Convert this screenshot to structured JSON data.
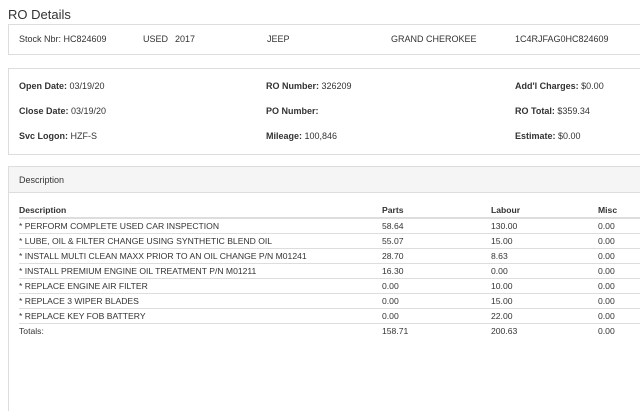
{
  "page_title": "RO Details",
  "vehicle": {
    "stock": "Stock Nbr: HC824609",
    "condition": "USED",
    "year": "2017",
    "make": "JEEP",
    "model": "GRAND CHEROKEE",
    "vin": "1C4RJFAG0HC824609"
  },
  "ro_info": {
    "open_date": {
      "label": "Open Date:",
      "value": "03/19/20"
    },
    "close_date": {
      "label": "Close Date:",
      "value": "03/19/20"
    },
    "svc_logon": {
      "label": "Svc Logon:",
      "value": "HZF-S"
    },
    "ro_number": {
      "label": "RO Number:",
      "value": "326209"
    },
    "po_number": {
      "label": "PO Number:",
      "value": ""
    },
    "mileage": {
      "label": "Mileage:",
      "value": "100,846"
    },
    "addl_charges": {
      "label": "Add'l Charges:",
      "value": "$0.00"
    },
    "ro_total": {
      "label": "RO Total:",
      "value": "$359.34"
    },
    "estimate": {
      "label": "Estimate:",
      "value": "$0.00"
    }
  },
  "description_panel": {
    "heading": "Description",
    "columns": {
      "description": "Description",
      "parts": "Parts",
      "labour": "Labour",
      "misc": "Misc"
    },
    "rows": [
      {
        "description": "* PERFORM COMPLETE USED CAR INSPECTION",
        "parts": "58.64",
        "labour": "130.00",
        "misc": "0.00"
      },
      {
        "description": "* LUBE, OIL & FILTER CHANGE USING SYNTHETIC BLEND OIL",
        "parts": "55.07",
        "labour": "15.00",
        "misc": "0.00"
      },
      {
        "description": "* INSTALL MULTI CLEAN MAXX PRIOR TO AN OIL CHANGE P/N M01241",
        "parts": "28.70",
        "labour": "8.63",
        "misc": "0.00"
      },
      {
        "description": "* INSTALL PREMIUM ENGINE OIL TREATMENT P/N M01211",
        "parts": "16.30",
        "labour": "0.00",
        "misc": "0.00"
      },
      {
        "description": "* REPLACE ENGINE AIR FILTER",
        "parts": "0.00",
        "labour": "10.00",
        "misc": "0.00"
      },
      {
        "description": "* REPLACE 3 WIPER BLADES",
        "parts": "0.00",
        "labour": "15.00",
        "misc": "0.00"
      },
      {
        "description": "* REPLACE KEY FOB BATTERY",
        "parts": "0.00",
        "labour": "22.00",
        "misc": "0.00"
      }
    ],
    "totals": {
      "label": "Totals:",
      "parts": "158.71",
      "labour": "200.63",
      "misc": "0.00"
    }
  }
}
